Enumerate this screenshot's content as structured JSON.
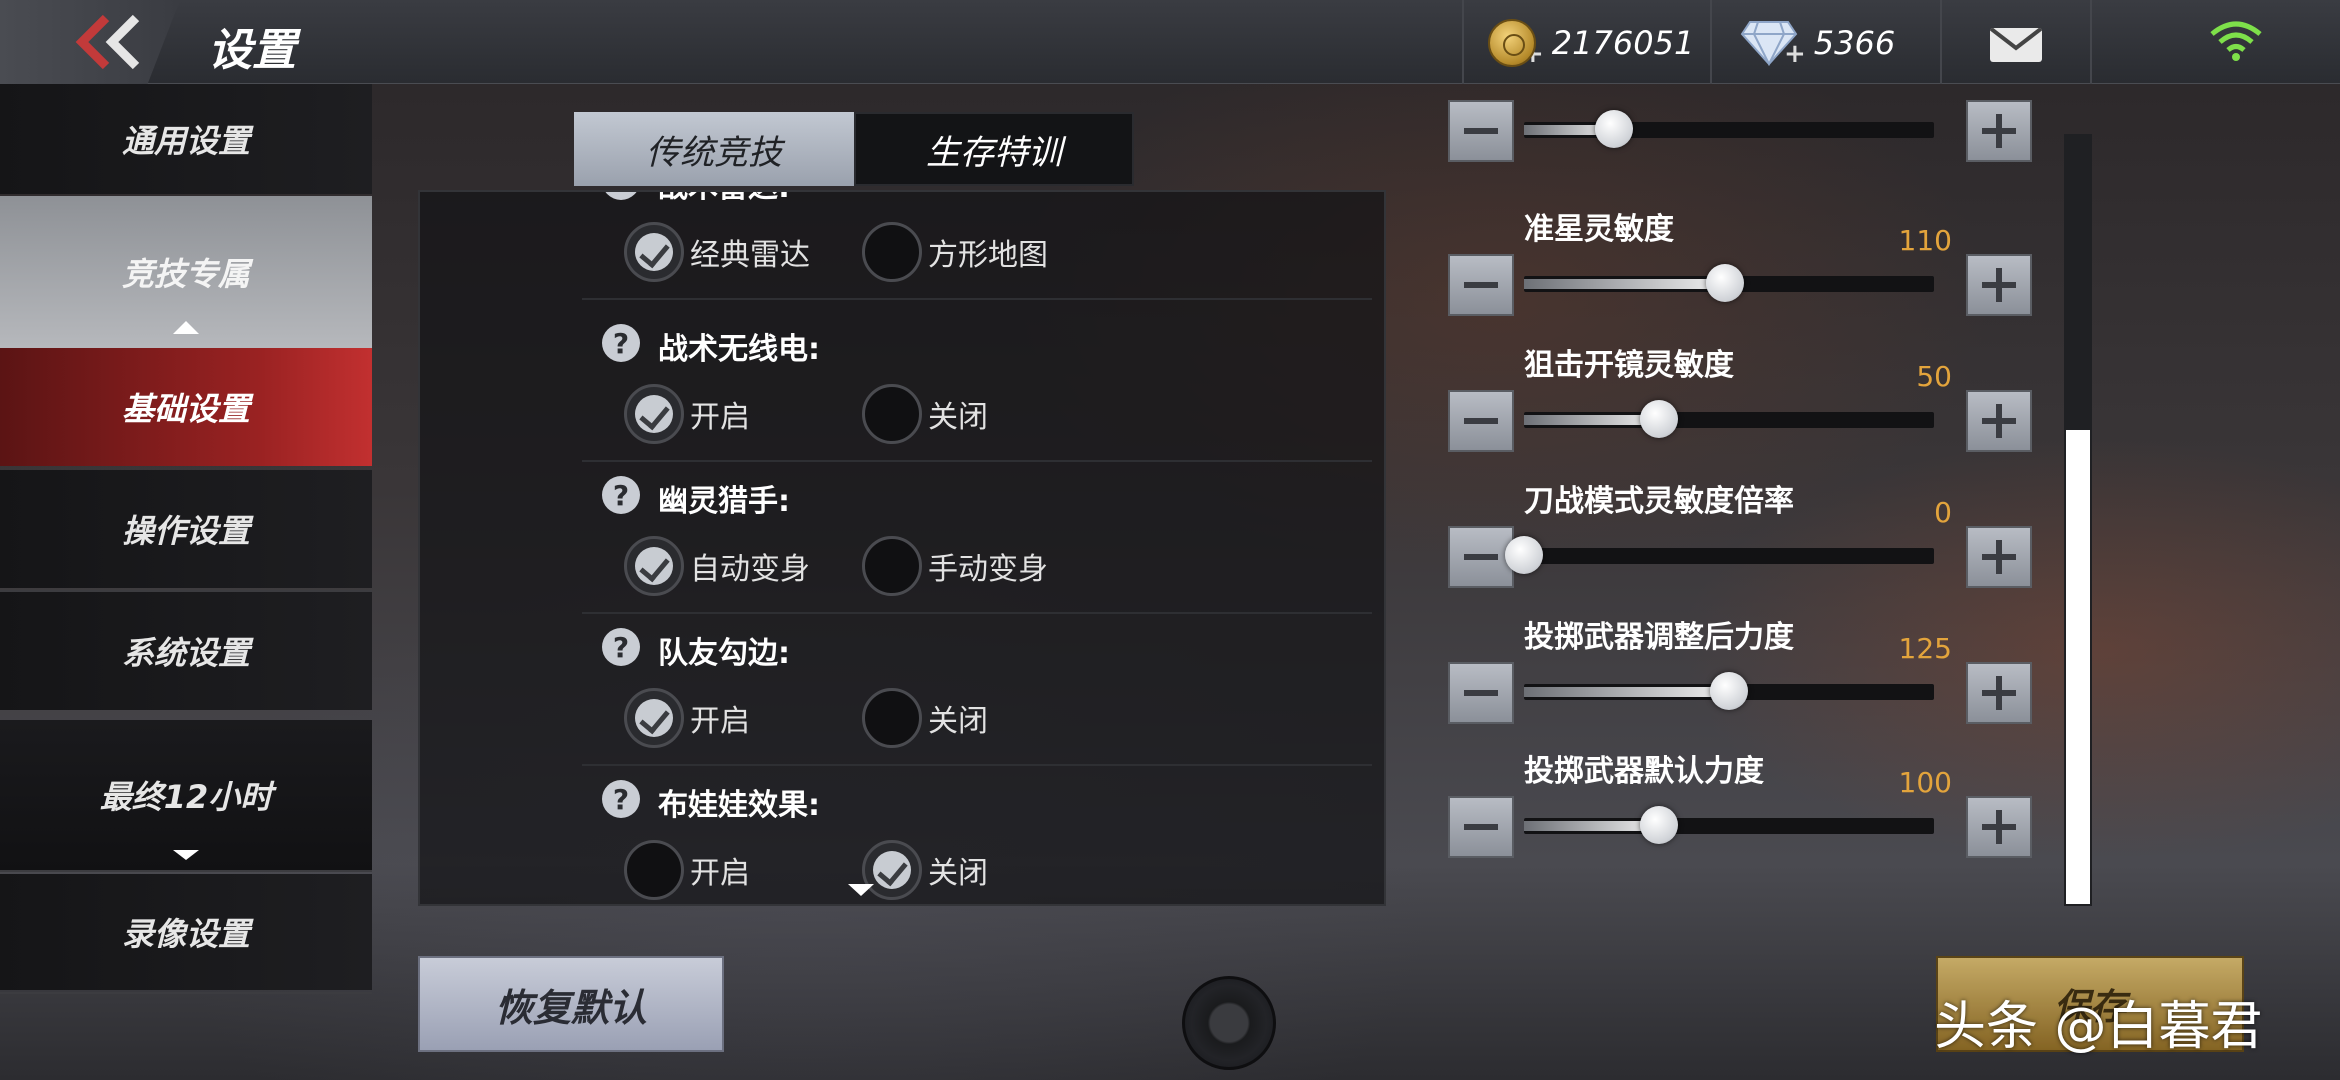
{
  "header": {
    "title": "设置",
    "coins": "2176051",
    "diamonds": "5366"
  },
  "sidebar": {
    "items": [
      {
        "label": "通用设置"
      },
      {
        "label": "竞技专属"
      },
      {
        "label": "基础设置"
      },
      {
        "label": "操作设置"
      },
      {
        "label": "系统设置"
      },
      {
        "label": "最终12小时"
      },
      {
        "label": "录像设置"
      }
    ]
  },
  "tabs": [
    {
      "label": "传统竞技",
      "active": true
    },
    {
      "label": "生存特训",
      "active": false
    }
  ],
  "settings": [
    {
      "label": "战术雷达:",
      "options": [
        "经典雷达",
        "方形地图"
      ],
      "selected": 0
    },
    {
      "label": "战术无线电:",
      "options": [
        "开启",
        "关闭"
      ],
      "selected": 0
    },
    {
      "label": "幽灵猎手:",
      "options": [
        "自动变身",
        "手动变身"
      ],
      "selected": 0
    },
    {
      "label": "队友勾边:",
      "options": [
        "开启",
        "关闭"
      ],
      "selected": 0
    },
    {
      "label": "布娃娃效果:",
      "options": [
        "开启",
        "关闭"
      ],
      "selected": 1
    }
  ],
  "sliders": [
    {
      "label": "",
      "value": "",
      "level": 0.22
    },
    {
      "label": "准星灵敏度",
      "value": "110",
      "level": 0.49
    },
    {
      "label": "狙击开镜灵敏度",
      "value": "50",
      "level": 0.33
    },
    {
      "label": "刀战模式灵敏度倍率",
      "value": "0",
      "level": 0.0
    },
    {
      "label": "投掷武器调整后力度",
      "value": "125",
      "level": 0.5
    },
    {
      "label": "投掷武器默认力度",
      "value": "100",
      "level": 0.33
    }
  ],
  "footer": {
    "reset_label": "恢复默认",
    "save_label": "保存",
    "watermark": "头条 @白暮君"
  },
  "colors": {
    "accent_red": "#c23030",
    "value_orange": "#e3a43c",
    "gold": "#d4b66a"
  }
}
